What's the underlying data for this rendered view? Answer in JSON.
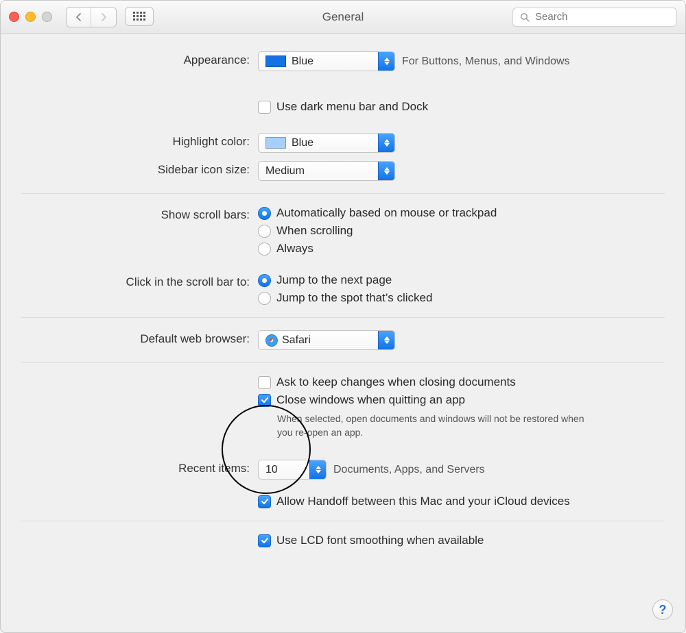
{
  "window": {
    "title": "General"
  },
  "search": {
    "placeholder": "Search"
  },
  "appearance": {
    "label": "Appearance:",
    "value": "Blue",
    "swatch": "#1672e3",
    "hint": "For Buttons, Menus, and Windows",
    "dark_menu_label": "Use dark menu bar and Dock",
    "dark_menu_checked": false
  },
  "highlight": {
    "label": "Highlight color:",
    "value": "Blue",
    "swatch": "#a6d0fb"
  },
  "sidebar": {
    "label": "Sidebar icon size:",
    "value": "Medium"
  },
  "scrollbars": {
    "label": "Show scroll bars:",
    "options": [
      {
        "label": "Automatically based on mouse or trackpad",
        "selected": true
      },
      {
        "label": "When scrolling",
        "selected": false
      },
      {
        "label": "Always",
        "selected": false
      }
    ]
  },
  "scrollclick": {
    "label": "Click in the scroll bar to:",
    "options": [
      {
        "label": "Jump to the next page",
        "selected": true
      },
      {
        "label": "Jump to the spot that’s clicked",
        "selected": false
      }
    ]
  },
  "browser": {
    "label": "Default web browser:",
    "value": "Safari"
  },
  "documents": {
    "ask_label": "Ask to keep changes when closing documents",
    "ask_checked": false,
    "close_label": "Close windows when quitting an app",
    "close_checked": true,
    "close_hint": "When selected, open documents and windows will not be restored when you re-open an app."
  },
  "recent": {
    "label": "Recent items:",
    "value": "10",
    "hint": "Documents, Apps, and Servers",
    "handoff_label": "Allow Handoff between this Mac and your iCloud devices",
    "handoff_checked": true
  },
  "lcd": {
    "label": "Use LCD font smoothing when available",
    "checked": true
  },
  "help": "?"
}
